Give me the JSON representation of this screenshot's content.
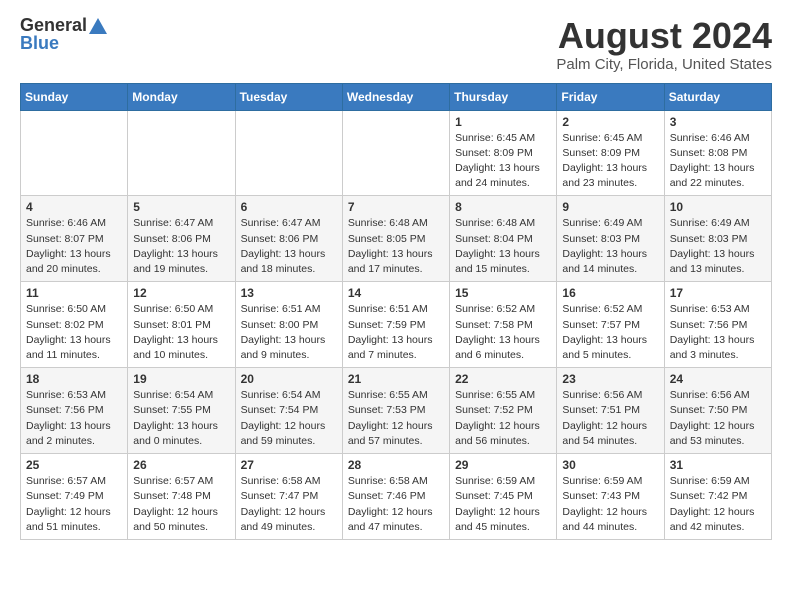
{
  "logo": {
    "general": "General",
    "blue": "Blue"
  },
  "header": {
    "month_year": "August 2024",
    "location": "Palm City, Florida, United States"
  },
  "weekdays": [
    "Sunday",
    "Monday",
    "Tuesday",
    "Wednesday",
    "Thursday",
    "Friday",
    "Saturday"
  ],
  "weeks": [
    [
      {
        "day": "",
        "info": ""
      },
      {
        "day": "",
        "info": ""
      },
      {
        "day": "",
        "info": ""
      },
      {
        "day": "",
        "info": ""
      },
      {
        "day": "1",
        "info": "Sunrise: 6:45 AM\nSunset: 8:09 PM\nDaylight: 13 hours\nand 24 minutes."
      },
      {
        "day": "2",
        "info": "Sunrise: 6:45 AM\nSunset: 8:09 PM\nDaylight: 13 hours\nand 23 minutes."
      },
      {
        "day": "3",
        "info": "Sunrise: 6:46 AM\nSunset: 8:08 PM\nDaylight: 13 hours\nand 22 minutes."
      }
    ],
    [
      {
        "day": "4",
        "info": "Sunrise: 6:46 AM\nSunset: 8:07 PM\nDaylight: 13 hours\nand 20 minutes."
      },
      {
        "day": "5",
        "info": "Sunrise: 6:47 AM\nSunset: 8:06 PM\nDaylight: 13 hours\nand 19 minutes."
      },
      {
        "day": "6",
        "info": "Sunrise: 6:47 AM\nSunset: 8:06 PM\nDaylight: 13 hours\nand 18 minutes."
      },
      {
        "day": "7",
        "info": "Sunrise: 6:48 AM\nSunset: 8:05 PM\nDaylight: 13 hours\nand 17 minutes."
      },
      {
        "day": "8",
        "info": "Sunrise: 6:48 AM\nSunset: 8:04 PM\nDaylight: 13 hours\nand 15 minutes."
      },
      {
        "day": "9",
        "info": "Sunrise: 6:49 AM\nSunset: 8:03 PM\nDaylight: 13 hours\nand 14 minutes."
      },
      {
        "day": "10",
        "info": "Sunrise: 6:49 AM\nSunset: 8:03 PM\nDaylight: 13 hours\nand 13 minutes."
      }
    ],
    [
      {
        "day": "11",
        "info": "Sunrise: 6:50 AM\nSunset: 8:02 PM\nDaylight: 13 hours\nand 11 minutes."
      },
      {
        "day": "12",
        "info": "Sunrise: 6:50 AM\nSunset: 8:01 PM\nDaylight: 13 hours\nand 10 minutes."
      },
      {
        "day": "13",
        "info": "Sunrise: 6:51 AM\nSunset: 8:00 PM\nDaylight: 13 hours\nand 9 minutes."
      },
      {
        "day": "14",
        "info": "Sunrise: 6:51 AM\nSunset: 7:59 PM\nDaylight: 13 hours\nand 7 minutes."
      },
      {
        "day": "15",
        "info": "Sunrise: 6:52 AM\nSunset: 7:58 PM\nDaylight: 13 hours\nand 6 minutes."
      },
      {
        "day": "16",
        "info": "Sunrise: 6:52 AM\nSunset: 7:57 PM\nDaylight: 13 hours\nand 5 minutes."
      },
      {
        "day": "17",
        "info": "Sunrise: 6:53 AM\nSunset: 7:56 PM\nDaylight: 13 hours\nand 3 minutes."
      }
    ],
    [
      {
        "day": "18",
        "info": "Sunrise: 6:53 AM\nSunset: 7:56 PM\nDaylight: 13 hours\nand 2 minutes."
      },
      {
        "day": "19",
        "info": "Sunrise: 6:54 AM\nSunset: 7:55 PM\nDaylight: 13 hours\nand 0 minutes."
      },
      {
        "day": "20",
        "info": "Sunrise: 6:54 AM\nSunset: 7:54 PM\nDaylight: 12 hours\nand 59 minutes."
      },
      {
        "day": "21",
        "info": "Sunrise: 6:55 AM\nSunset: 7:53 PM\nDaylight: 12 hours\nand 57 minutes."
      },
      {
        "day": "22",
        "info": "Sunrise: 6:55 AM\nSunset: 7:52 PM\nDaylight: 12 hours\nand 56 minutes."
      },
      {
        "day": "23",
        "info": "Sunrise: 6:56 AM\nSunset: 7:51 PM\nDaylight: 12 hours\nand 54 minutes."
      },
      {
        "day": "24",
        "info": "Sunrise: 6:56 AM\nSunset: 7:50 PM\nDaylight: 12 hours\nand 53 minutes."
      }
    ],
    [
      {
        "day": "25",
        "info": "Sunrise: 6:57 AM\nSunset: 7:49 PM\nDaylight: 12 hours\nand 51 minutes."
      },
      {
        "day": "26",
        "info": "Sunrise: 6:57 AM\nSunset: 7:48 PM\nDaylight: 12 hours\nand 50 minutes."
      },
      {
        "day": "27",
        "info": "Sunrise: 6:58 AM\nSunset: 7:47 PM\nDaylight: 12 hours\nand 49 minutes."
      },
      {
        "day": "28",
        "info": "Sunrise: 6:58 AM\nSunset: 7:46 PM\nDaylight: 12 hours\nand 47 minutes."
      },
      {
        "day": "29",
        "info": "Sunrise: 6:59 AM\nSunset: 7:45 PM\nDaylight: 12 hours\nand 45 minutes."
      },
      {
        "day": "30",
        "info": "Sunrise: 6:59 AM\nSunset: 7:43 PM\nDaylight: 12 hours\nand 44 minutes."
      },
      {
        "day": "31",
        "info": "Sunrise: 6:59 AM\nSunset: 7:42 PM\nDaylight: 12 hours\nand 42 minutes."
      }
    ]
  ]
}
